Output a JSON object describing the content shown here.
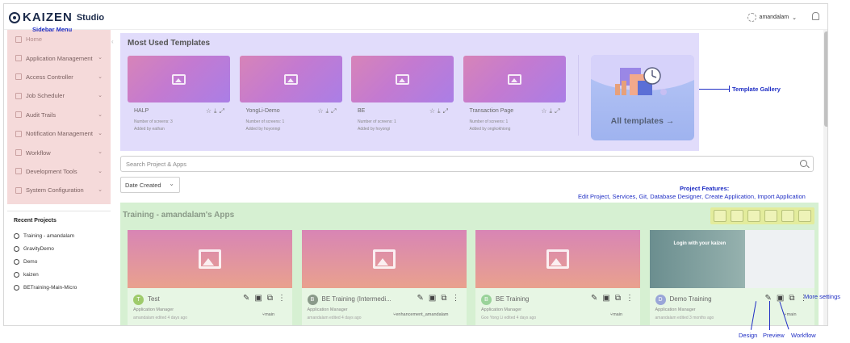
{
  "header": {
    "brand": "KAIZEN",
    "brand_suffix": "Studio",
    "user_name": "amandalam"
  },
  "sidebar": {
    "items": [
      {
        "label": "Home",
        "chevron": false
      },
      {
        "label": "Application Management",
        "chevron": true
      },
      {
        "label": "Access Controller",
        "chevron": true
      },
      {
        "label": "Job Scheduler",
        "chevron": true
      },
      {
        "label": "Audit Trails",
        "chevron": true
      },
      {
        "label": "Notification Management",
        "chevron": true
      },
      {
        "label": "Workflow",
        "chevron": true
      },
      {
        "label": "Development Tools",
        "chevron": true
      },
      {
        "label": "System Configuration",
        "chevron": true
      }
    ]
  },
  "recent_projects": {
    "title": "Recent Projects",
    "items": [
      "Training - amandalam",
      "GravityDemo",
      "Demo",
      "kaizen",
      "BETraining-Main-Micro"
    ]
  },
  "templates": {
    "title": "Most Used Templates",
    "cards": [
      {
        "name": "HALP",
        "screens": "Number of screens: 3",
        "added": "Added by eathan"
      },
      {
        "name": "YongLi-Demo",
        "screens": "Number of screens: 1",
        "added": "Added by hoyonngi"
      },
      {
        "name": "BE",
        "screens": "Number of screens: 1",
        "added": "Added by hoyongi"
      },
      {
        "name": "Transaction Page",
        "screens": "Number of screens: 1",
        "added": "Added by ongkokhiong"
      }
    ],
    "all_label": "All templates →"
  },
  "search": {
    "placeholder": "Search Project & Apps"
  },
  "sort": {
    "value": "Date Created"
  },
  "apps": {
    "title": "Training - amandalam's Apps",
    "cards": [
      {
        "name": "Test",
        "initial": "T",
        "avatar_color": "#9ecb6b",
        "type": "Application Manager",
        "edited": "amandalam edited 4 days ago",
        "branch": "main",
        "thumb": "placeholder"
      },
      {
        "name": "BE Training (Intermedi...",
        "initial": "B",
        "avatar_color": "#8a9a8a",
        "type": "Application Manager",
        "edited": "amandalam edited 4 days ago",
        "branch": "enhancement_amandalam",
        "thumb": "placeholder"
      },
      {
        "name": "BE Training",
        "initial": "B",
        "avatar_color": "#9ad39a",
        "type": "Application Manager",
        "edited": "Goo Yong Li edited 4 days ago",
        "branch": "main",
        "thumb": "placeholder"
      },
      {
        "name": "Demo Training",
        "initial": "D",
        "avatar_color": "#9aa6d8",
        "type": "Application Manager",
        "edited": "amandalam edited 3 months ago",
        "branch": "main",
        "thumb": "screenshot",
        "shot_text": "Login with your kaizen"
      }
    ]
  },
  "annotations": {
    "sidebar_menu": "Sidebar Menu",
    "template_gallery": "Template Gallery",
    "project_features_title": "Project Features:",
    "project_features_list": "Edit Project, Services, Git, Database Designer, Create Application, Import Application",
    "more_settings": "More settings",
    "design": "Design",
    "preview": "Preview",
    "workflow": "Workflow"
  },
  "colors": {
    "annotation": "#1f2ec4",
    "templates_bg": "#e1dcfb",
    "apps_bg": "#d6f0d2",
    "sidebar_bg": "#f5dada"
  }
}
